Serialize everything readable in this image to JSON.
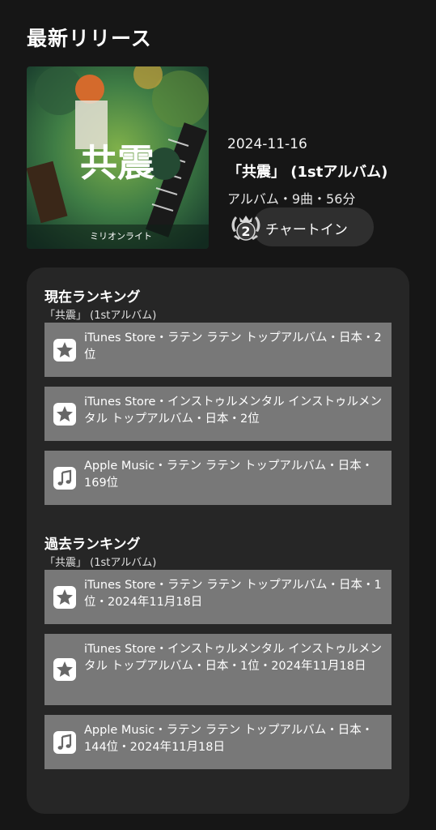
{
  "section_title": "最新リリース",
  "release": {
    "date": "2024-11-16",
    "title": "「共震」 (1stアルバム)",
    "meta": "アルバム・9曲・56分",
    "cover_title_text": "共震",
    "cover_artist_text": "ミリオンライト",
    "chart_badge": {
      "rank": "2",
      "label": "チャートイン"
    }
  },
  "current_ranking": {
    "heading": "現在ランキング",
    "subtitle": "「共震」 (1stアルバム)",
    "items": [
      {
        "icon": "star-icon",
        "text": "iTunes Store・ラテン ラテン トップアルバム・日本・2位"
      },
      {
        "icon": "star-icon",
        "text": "iTunes Store・インストゥルメンタル インストゥルメンタル トップアルバム・日本・2位"
      },
      {
        "icon": "music-note-icon",
        "text": "Apple Music・ラテン ラテン トップアルバム・日本・169位"
      }
    ]
  },
  "past_ranking": {
    "heading": "過去ランキング",
    "subtitle": "「共震」 (1stアルバム)",
    "items": [
      {
        "icon": "star-icon",
        "text": "iTunes Store・ラテン ラテン トップアルバム・日本・1位・2024年11月18日"
      },
      {
        "icon": "star-icon",
        "text": "iTunes Store・インストゥルメンタル インストゥルメンタル トップアルバム・日本・1位・2024年11月18日"
      },
      {
        "icon": "music-note-icon",
        "text": "Apple Music・ラテン ラテン トップアルバム・日本・144位・2024年11月18日"
      }
    ]
  },
  "colors": {
    "background": "#161616",
    "card": "#262626",
    "item": "#787878",
    "pill": "#2f2f2f"
  }
}
